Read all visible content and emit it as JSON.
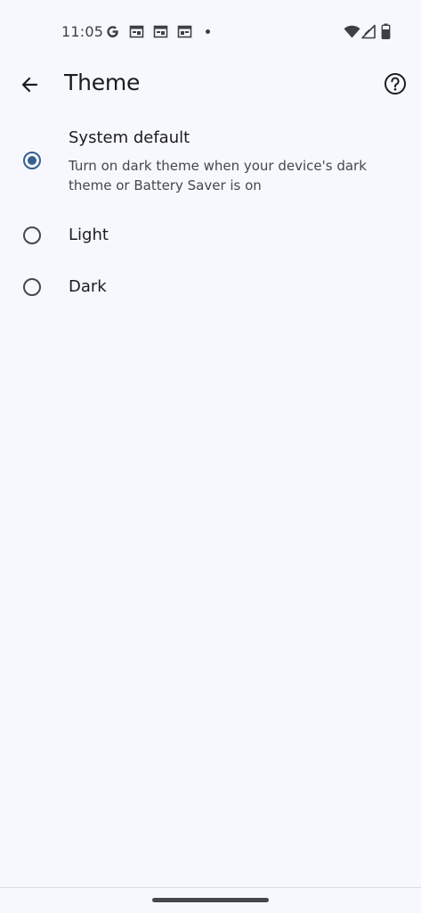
{
  "status_bar": {
    "time": "11:05",
    "left_icons": [
      "google-g-icon",
      "calendar-icon",
      "calendar-icon",
      "calendar-icon",
      "notification-dot-icon"
    ],
    "right_icons": [
      "wifi-icon",
      "cell-signal-icon",
      "battery-icon"
    ]
  },
  "app_bar": {
    "title": "Theme",
    "back_icon": "arrow-back-icon",
    "help_icon": "help-circle-icon"
  },
  "options": [
    {
      "label": "System default",
      "description": "Turn on dark theme when your device's dark theme or Battery Saver is on",
      "selected": true
    },
    {
      "label": "Light",
      "selected": false
    },
    {
      "label": "Dark",
      "selected": false
    }
  ],
  "colors": {
    "background": "#f7f8fd",
    "accent": "#355f8f",
    "text_primary": "#1b1c1f",
    "text_secondary": "#44474e"
  }
}
